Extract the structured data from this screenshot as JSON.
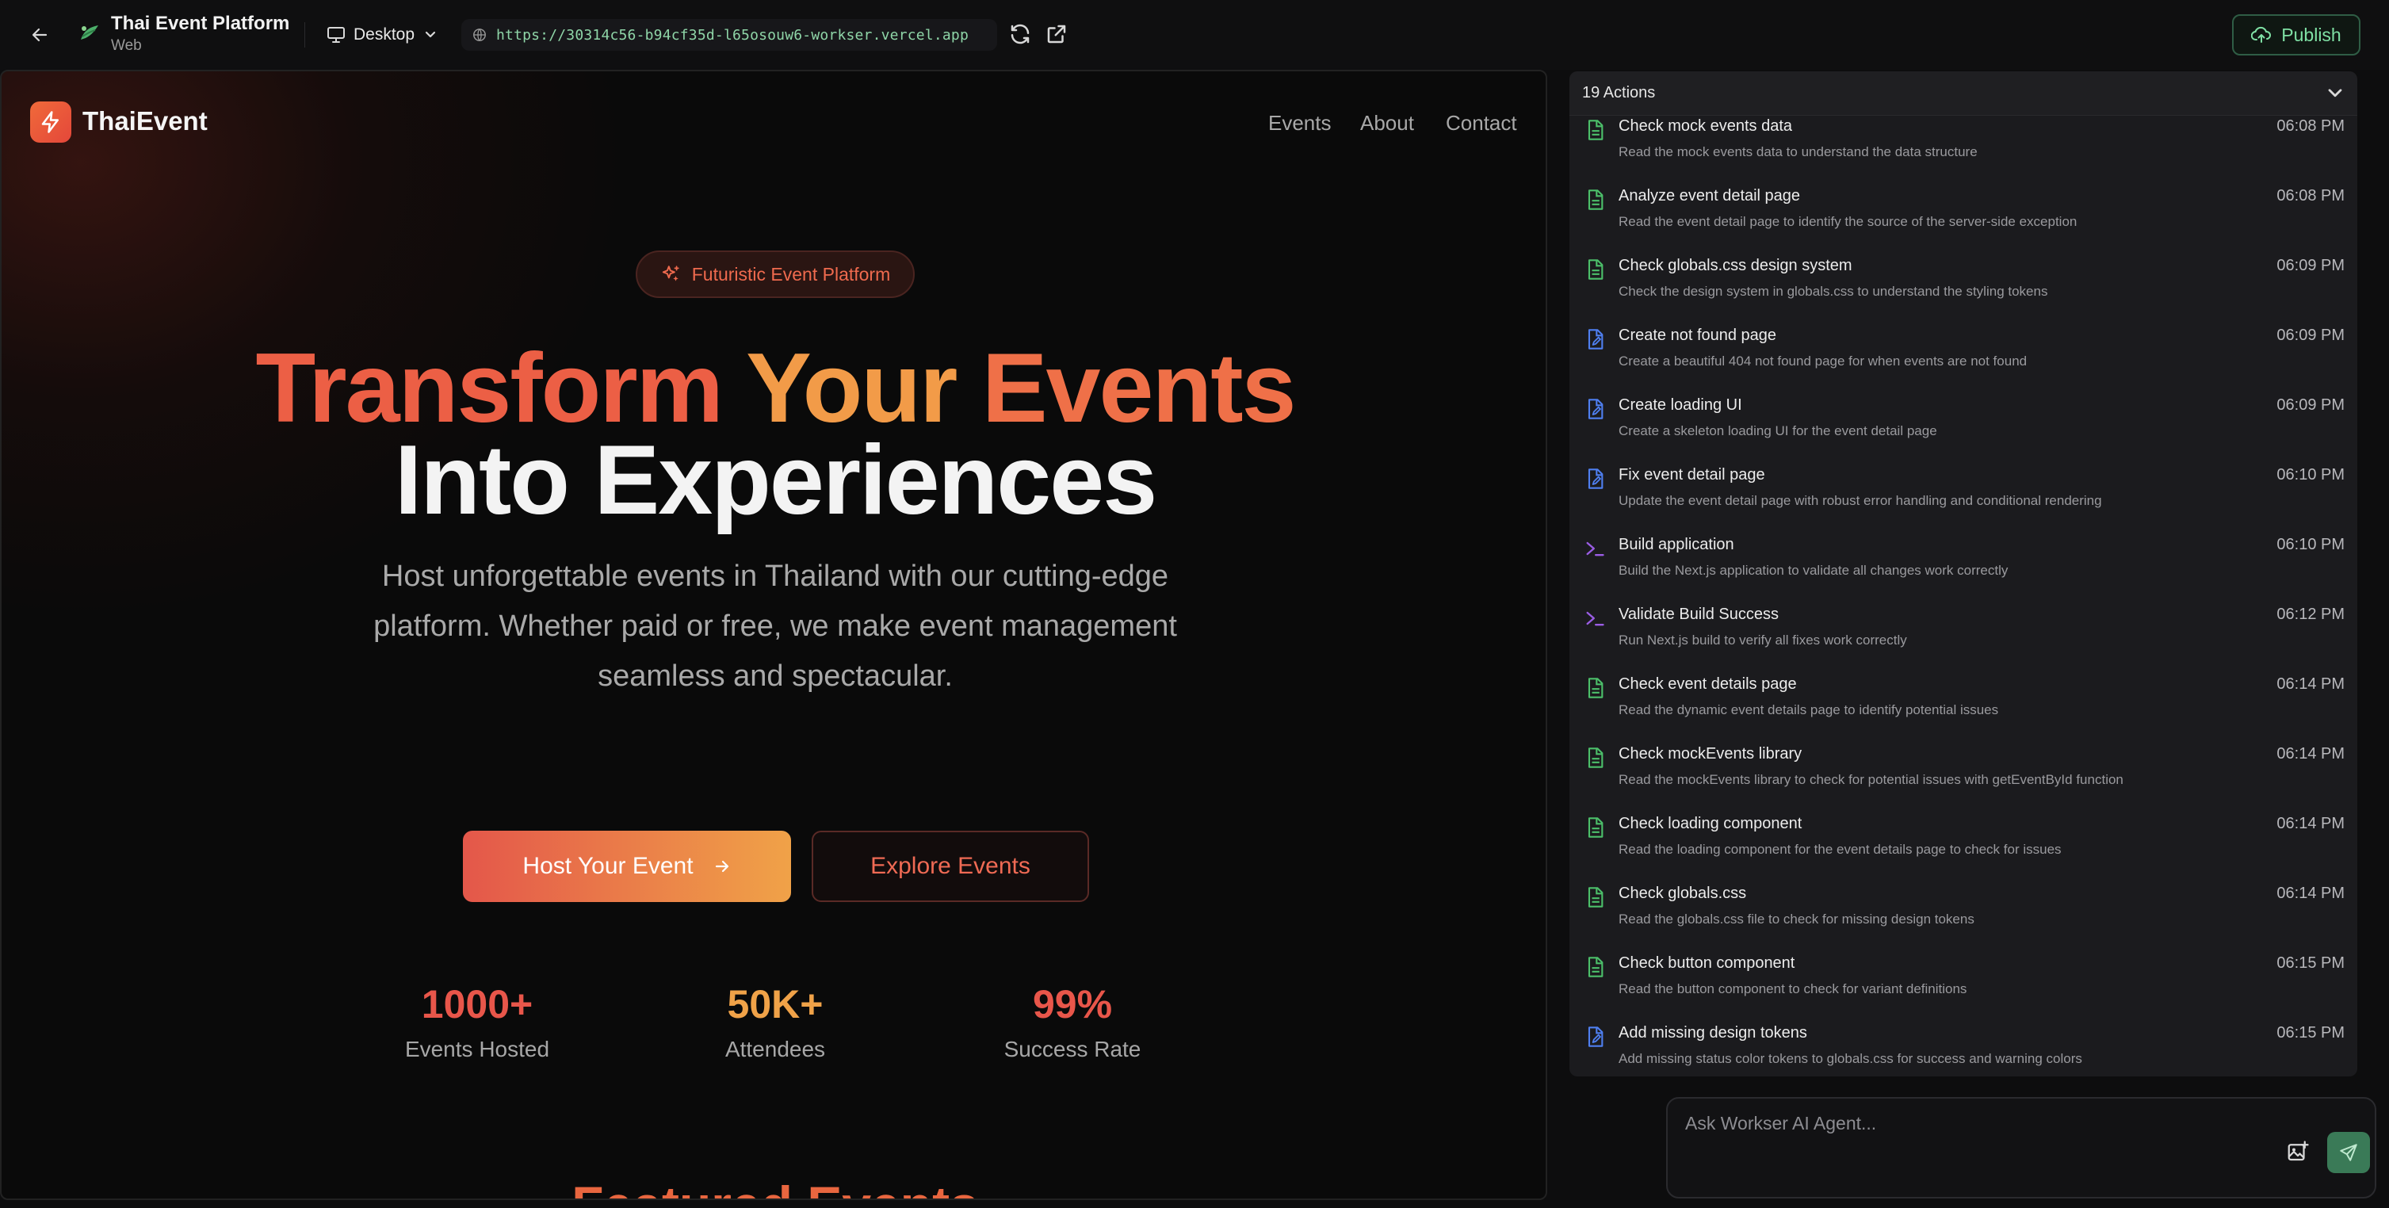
{
  "topbar": {
    "project_title": "Thai Event Platform",
    "project_subtitle": "Web",
    "device_label": "Desktop",
    "url": "https://30314c56-b94cf35d-l65osouw6-workser.vercel.app",
    "publish_label": "Publish"
  },
  "site": {
    "brand": "ThaiEvent",
    "nav": [
      "Events",
      "About",
      "Contact"
    ],
    "badge": "Futuristic Event Platform",
    "headline": {
      "word1": "Transform",
      "word2": "Your",
      "word3": "Events",
      "line2": "Into Experiences"
    },
    "lead": "Host unforgettable events in Thailand with our cutting-edge platform. Whether paid or free, we make event management seamless and spectacular.",
    "primary_cta": "Host Your Event",
    "secondary_cta": "Explore Events",
    "stats": [
      {
        "value": "1000+",
        "label": "Events Hosted",
        "color": "#e8564a"
      },
      {
        "value": "50K+",
        "label": "Attendees",
        "color": "#f0a248"
      },
      {
        "value": "99%",
        "label": "Success Rate",
        "color": "#e8564a"
      }
    ],
    "featured_heading": "Featured Events"
  },
  "panel": {
    "header": "19 Actions",
    "actions": [
      {
        "icon": "file-read-icon",
        "title": "Check mock events data",
        "desc": "Read the mock events data to understand the data structure",
        "time": "06:08 PM"
      },
      {
        "icon": "file-read-icon",
        "title": "Analyze event detail page",
        "desc": "Read the event detail page to identify the source of the server-side exception",
        "time": "06:08 PM"
      },
      {
        "icon": "file-read-icon",
        "title": "Check globals.css design system",
        "desc": "Check the design system in globals.css to understand the styling tokens",
        "time": "06:09 PM"
      },
      {
        "icon": "file-edit-icon",
        "title": "Create not found page",
        "desc": "Create a beautiful 404 not found page for when events are not found",
        "time": "06:09 PM"
      },
      {
        "icon": "file-edit-icon",
        "title": "Create loading UI",
        "desc": "Create a skeleton loading UI for the event detail page",
        "time": "06:09 PM"
      },
      {
        "icon": "file-edit-icon",
        "title": "Fix event detail page",
        "desc": "Update the event detail page with robust error handling and conditional rendering",
        "time": "06:10 PM"
      },
      {
        "icon": "terminal-icon",
        "title": "Build application",
        "desc": "Build the Next.js application to validate all changes work correctly",
        "time": "06:10 PM"
      },
      {
        "icon": "terminal-icon",
        "title": "Validate Build Success",
        "desc": "Run Next.js build to verify all fixes work correctly",
        "time": "06:12 PM"
      },
      {
        "icon": "file-read-icon",
        "title": "Check event details page",
        "desc": "Read the dynamic event details page to identify potential issues",
        "time": "06:14 PM"
      },
      {
        "icon": "file-read-icon",
        "title": "Check mockEvents library",
        "desc": "Read the mockEvents library to check for potential issues with getEventById function",
        "time": "06:14 PM"
      },
      {
        "icon": "file-read-icon",
        "title": "Check loading component",
        "desc": "Read the loading component for the event details page to check for issues",
        "time": "06:14 PM"
      },
      {
        "icon": "file-read-icon",
        "title": "Check globals.css",
        "desc": "Read the globals.css file to check for missing design tokens",
        "time": "06:14 PM"
      },
      {
        "icon": "file-read-icon",
        "title": "Check button component",
        "desc": "Read the button component to check for variant definitions",
        "time": "06:15 PM"
      },
      {
        "icon": "file-edit-icon",
        "title": "Add missing design tokens",
        "desc": "Add missing status color tokens to globals.css for success and warning colors",
        "time": "06:15 PM"
      }
    ]
  },
  "chat": {
    "placeholder": "Ask Workser AI Agent..."
  },
  "colors": {
    "accent_green": "#7fe0a4",
    "brand_orange": "#f06a3a",
    "read_icon": "#4cc06a",
    "edit_icon": "#4f7ff0",
    "terminal_icon": "#9b5de5"
  }
}
